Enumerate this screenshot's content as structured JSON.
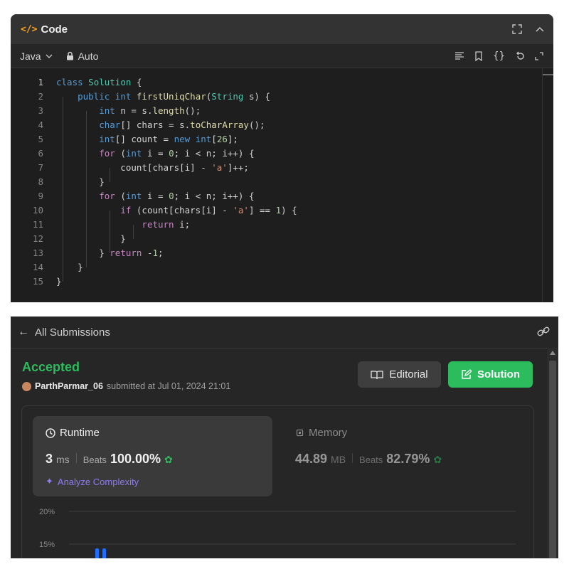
{
  "code": {
    "title": "Code",
    "title_icon": "</>",
    "language": "Java",
    "mode": "Auto",
    "lines": [
      {
        "num": "1"
      },
      {
        "num": "2"
      },
      {
        "num": "3"
      },
      {
        "num": "4"
      },
      {
        "num": "5"
      },
      {
        "num": "6"
      },
      {
        "num": "7"
      },
      {
        "num": "8"
      },
      {
        "num": "9"
      },
      {
        "num": "10"
      },
      {
        "num": "11"
      },
      {
        "num": "12"
      },
      {
        "num": "13"
      },
      {
        "num": "14"
      },
      {
        "num": "15"
      }
    ],
    "source": [
      "class Solution {",
      "    public int firstUniqChar(String s) {",
      "        int n = s.length();",
      "        char[] chars = s.toCharArray();",
      "        int[] count = new int[26];",
      "        for (int i = 0; i < n; i++) {",
      "            count[chars[i] - 'a']++;",
      "        }",
      "        for (int i = 0; i < n; i++) {",
      "            if (count[chars[i] - 'a'] == 1) {",
      "                return i;",
      "            }",
      "        } return -1;",
      "    }",
      "}"
    ]
  },
  "submission": {
    "back_label": "All Submissions",
    "status": "Accepted",
    "username": "ParthParmar_06",
    "submitted_text": "submitted at Jul 01, 2024 21:01",
    "editorial_label": "Editorial",
    "solution_label": "Solution",
    "runtime": {
      "title": "Runtime",
      "value": "3",
      "unit": "ms",
      "beats_label": "Beats",
      "beats_value": "100.00%",
      "analyze_label": "Analyze Complexity"
    },
    "memory": {
      "title": "Memory",
      "value": "44.89",
      "unit": "MB",
      "beats_label": "Beats",
      "beats_value": "82.79%"
    }
  },
  "chart_data": {
    "type": "bar",
    "y_ticks": [
      "20%",
      "15%"
    ],
    "note": "distribution chart partially visible; only top of bars shown"
  },
  "colors": {
    "accent_green": "#2cbb5d",
    "accent_orange": "#ffa116",
    "analyze_purple": "#8c7bf0",
    "bar_blue": "#1e6fff"
  }
}
